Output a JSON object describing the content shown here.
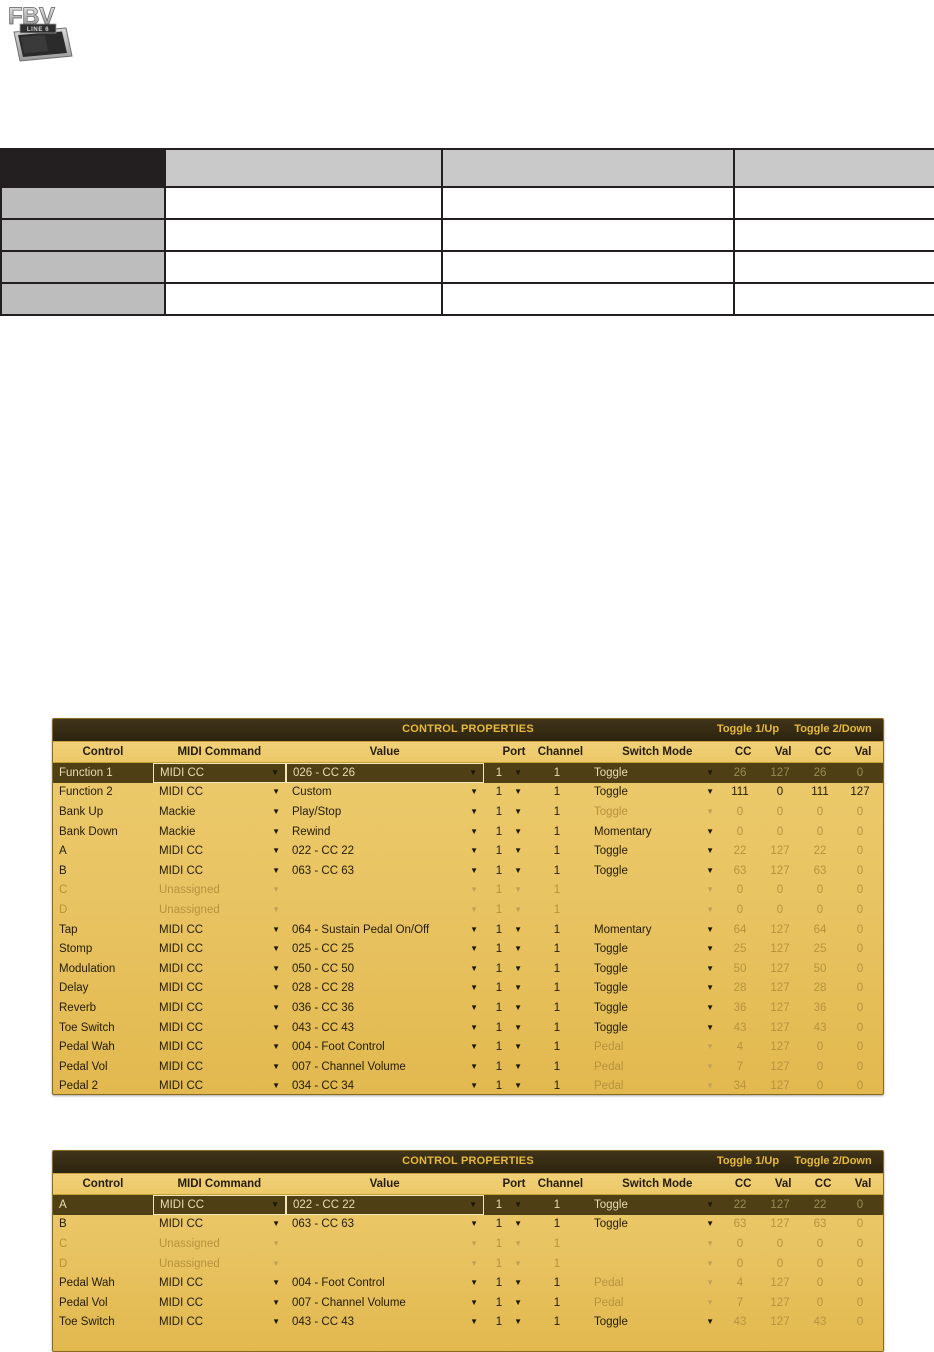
{
  "logo": {
    "brand": "FBV",
    "sub_brand": "LINE 6",
    "icon": "fbv-pedal-logo"
  },
  "spec_table": {
    "columns": 4,
    "header": [
      "",
      "",
      "",
      ""
    ],
    "rows": [
      [
        "",
        "",
        "",
        ""
      ],
      [
        "",
        "",
        "",
        ""
      ],
      [
        "",
        "",
        "",
        ""
      ],
      [
        "",
        "",
        "",
        ""
      ]
    ]
  },
  "colors": {
    "panel_gold": "#e9c463",
    "panel_gold_light": "#eccb6d",
    "selected_row": "#4e3f14",
    "title_text": "#e8b93a",
    "titlebar_dark": "#352b13",
    "table_header_dark": "#231f20",
    "table_header_gray": "#c9c9c9",
    "table_cell_gray": "#bdbdbd",
    "dim_text": "#b7933f"
  },
  "panel_common": {
    "title": "CONTROL PROPERTIES",
    "toggle1_label": "Toggle 1/Up",
    "toggle2_label": "Toggle 2/Down",
    "headers": {
      "control": "Control",
      "midi_command": "MIDI Command",
      "value": "Value",
      "port": "Port",
      "channel": "Channel",
      "switch_mode": "Switch Mode",
      "cc1": "CC",
      "val1": "Val",
      "cc2": "CC",
      "val2": "Val"
    },
    "dropdown_icon": "chevron-down-icon"
  },
  "panel1": {
    "rows": [
      {
        "control": "Function 1",
        "command": "MIDI CC",
        "value": "026 - CC 26",
        "port": "1",
        "channel": "1",
        "switch": "Toggle",
        "cc1": "26",
        "val1": "127",
        "cc2": "26",
        "val2": "0",
        "selected": true,
        "dim": true
      },
      {
        "control": "Function 2",
        "command": "MIDI CC",
        "value": "Custom",
        "port": "1",
        "channel": "1",
        "switch": "Toggle",
        "cc1": "111",
        "val1": "0",
        "cc2": "111",
        "val2": "127",
        "selected": false,
        "dim": false
      },
      {
        "control": "Bank Up",
        "command": "Mackie",
        "value": "Play/Stop",
        "port": "1",
        "channel": "1",
        "switch": "Toggle",
        "cc1": "0",
        "val1": "0",
        "cc2": "0",
        "val2": "0",
        "selected": false,
        "dim": true,
        "switch_dim": true
      },
      {
        "control": "Bank Down",
        "command": "Mackie",
        "value": "Rewind",
        "port": "1",
        "channel": "1",
        "switch": "Momentary",
        "cc1": "0",
        "val1": "0",
        "cc2": "0",
        "val2": "0",
        "selected": false,
        "dim": true,
        "switch_dim": false
      },
      {
        "control": "A",
        "command": "MIDI CC",
        "value": "022 - CC 22",
        "port": "1",
        "channel": "1",
        "switch": "Toggle",
        "cc1": "22",
        "val1": "127",
        "cc2": "22",
        "val2": "0",
        "selected": false,
        "dim": true
      },
      {
        "control": "B",
        "command": "MIDI CC",
        "value": "063 - CC 63",
        "port": "1",
        "channel": "1",
        "switch": "Toggle",
        "cc1": "63",
        "val1": "127",
        "cc2": "63",
        "val2": "0",
        "selected": false,
        "dim": true
      },
      {
        "control": "C",
        "command": "Unassigned",
        "value": "",
        "port": "1",
        "channel": "1",
        "switch": "",
        "cc1": "0",
        "val1": "0",
        "cc2": "0",
        "val2": "0",
        "selected": false,
        "dim": true,
        "row_dim": true
      },
      {
        "control": "D",
        "command": "Unassigned",
        "value": "",
        "port": "1",
        "channel": "1",
        "switch": "",
        "cc1": "0",
        "val1": "0",
        "cc2": "0",
        "val2": "0",
        "selected": false,
        "dim": true,
        "row_dim": true
      },
      {
        "control": "Tap",
        "command": "MIDI CC",
        "value": "064 - Sustain Pedal On/Off",
        "port": "1",
        "channel": "1",
        "switch": "Momentary",
        "cc1": "64",
        "val1": "127",
        "cc2": "64",
        "val2": "0",
        "selected": false,
        "dim": true
      },
      {
        "control": "Stomp",
        "command": "MIDI CC",
        "value": "025 - CC 25",
        "port": "1",
        "channel": "1",
        "switch": "Toggle",
        "cc1": "25",
        "val1": "127",
        "cc2": "25",
        "val2": "0",
        "selected": false,
        "dim": true
      },
      {
        "control": "Modulation",
        "command": "MIDI CC",
        "value": "050 - CC 50",
        "port": "1",
        "channel": "1",
        "switch": "Toggle",
        "cc1": "50",
        "val1": "127",
        "cc2": "50",
        "val2": "0",
        "selected": false,
        "dim": true
      },
      {
        "control": "Delay",
        "command": "MIDI CC",
        "value": "028 - CC 28",
        "port": "1",
        "channel": "1",
        "switch": "Toggle",
        "cc1": "28",
        "val1": "127",
        "cc2": "28",
        "val2": "0",
        "selected": false,
        "dim": true
      },
      {
        "control": "Reverb",
        "command": "MIDI CC",
        "value": "036 - CC 36",
        "port": "1",
        "channel": "1",
        "switch": "Toggle",
        "cc1": "36",
        "val1": "127",
        "cc2": "36",
        "val2": "0",
        "selected": false,
        "dim": true
      },
      {
        "control": "Toe Switch",
        "command": "MIDI CC",
        "value": "043 - CC 43",
        "port": "1",
        "channel": "1",
        "switch": "Toggle",
        "cc1": "43",
        "val1": "127",
        "cc2": "43",
        "val2": "0",
        "selected": false,
        "dim": true
      },
      {
        "control": "Pedal Wah",
        "command": "MIDI CC",
        "value": "004 - Foot Control",
        "port": "1",
        "channel": "1",
        "switch": "Pedal",
        "cc1": "4",
        "val1": "127",
        "cc2": "0",
        "val2": "0",
        "selected": false,
        "dim": true,
        "switch_dim": true
      },
      {
        "control": "Pedal Vol",
        "command": "MIDI CC",
        "value": "007 - Channel Volume",
        "port": "1",
        "channel": "1",
        "switch": "Pedal",
        "cc1": "7",
        "val1": "127",
        "cc2": "0",
        "val2": "0",
        "selected": false,
        "dim": true,
        "switch_dim": true
      },
      {
        "control": "Pedal 2",
        "command": "MIDI CC",
        "value": "034 - CC 34",
        "port": "1",
        "channel": "1",
        "switch": "Pedal",
        "cc1": "34",
        "val1": "127",
        "cc2": "0",
        "val2": "0",
        "selected": false,
        "dim": true,
        "switch_dim": true
      }
    ]
  },
  "panel2": {
    "rows": [
      {
        "control": "A",
        "command": "MIDI CC",
        "value": "022 - CC 22",
        "port": "1",
        "channel": "1",
        "switch": "Toggle",
        "cc1": "22",
        "val1": "127",
        "cc2": "22",
        "val2": "0",
        "selected": true,
        "dim": true
      },
      {
        "control": "B",
        "command": "MIDI CC",
        "value": "063 - CC 63",
        "port": "1",
        "channel": "1",
        "switch": "Toggle",
        "cc1": "63",
        "val1": "127",
        "cc2": "63",
        "val2": "0",
        "selected": false,
        "dim": true
      },
      {
        "control": "C",
        "command": "Unassigned",
        "value": "",
        "port": "1",
        "channel": "1",
        "switch": "",
        "cc1": "0",
        "val1": "0",
        "cc2": "0",
        "val2": "0",
        "selected": false,
        "dim": true,
        "row_dim": true
      },
      {
        "control": "D",
        "command": "Unassigned",
        "value": "",
        "port": "1",
        "channel": "1",
        "switch": "",
        "cc1": "0",
        "val1": "0",
        "cc2": "0",
        "val2": "0",
        "selected": false,
        "dim": true,
        "row_dim": true
      },
      {
        "control": "Pedal Wah",
        "command": "MIDI CC",
        "value": "004 - Foot Control",
        "port": "1",
        "channel": "1",
        "switch": "Pedal",
        "cc1": "4",
        "val1": "127",
        "cc2": "0",
        "val2": "0",
        "selected": false,
        "dim": true,
        "switch_dim": true
      },
      {
        "control": "Pedal Vol",
        "command": "MIDI CC",
        "value": "007 - Channel Volume",
        "port": "1",
        "channel": "1",
        "switch": "Pedal",
        "cc1": "7",
        "val1": "127",
        "cc2": "0",
        "val2": "0",
        "selected": false,
        "dim": true,
        "switch_dim": true
      },
      {
        "control": "Toe Switch",
        "command": "MIDI CC",
        "value": "043 - CC 43",
        "port": "1",
        "channel": "1",
        "switch": "Toggle",
        "cc1": "43",
        "val1": "127",
        "cc2": "43",
        "val2": "0",
        "selected": false,
        "dim": true
      }
    ]
  }
}
